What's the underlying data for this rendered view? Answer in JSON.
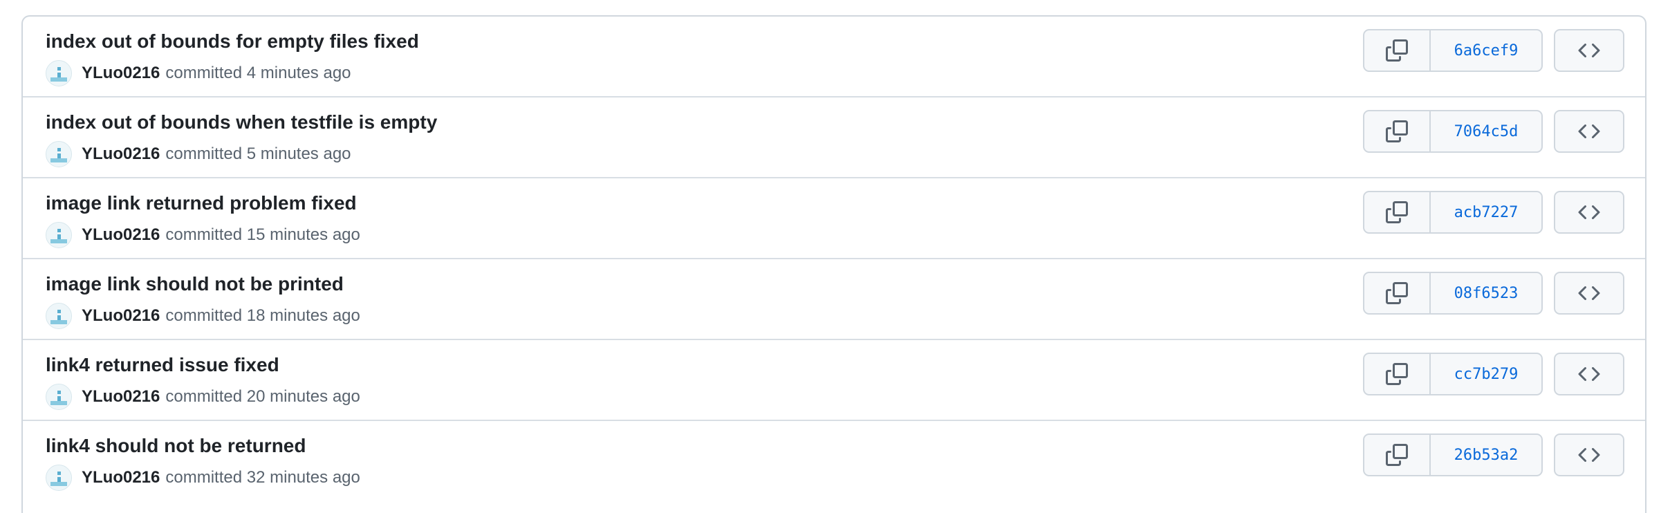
{
  "commits": [
    {
      "title": "index out of bounds for empty files fixed",
      "author": "YLuo0216",
      "committed_text": "committed 4 minutes ago",
      "sha": "6a6cef9"
    },
    {
      "title": "index out of bounds when testfile is empty",
      "author": "YLuo0216",
      "committed_text": "committed 5 minutes ago",
      "sha": "7064c5d"
    },
    {
      "title": "image link returned problem fixed",
      "author": "YLuo0216",
      "committed_text": "committed 15 minutes ago",
      "sha": "acb7227"
    },
    {
      "title": "image link should not be printed",
      "author": "YLuo0216",
      "committed_text": "committed 18 minutes ago",
      "sha": "08f6523"
    },
    {
      "title": "link4 returned issue fixed",
      "author": "YLuo0216",
      "committed_text": "committed 20 minutes ago",
      "sha": "cc7b279"
    },
    {
      "title": "link4 should not be returned",
      "author": "YLuo0216",
      "committed_text": "committed 32 minutes ago",
      "sha": "26b53a2"
    }
  ],
  "icons": {
    "copy": "copy-icon",
    "browse": "code-icon",
    "avatar": "avatar"
  },
  "colors": {
    "sha_link": "#0969da",
    "border": "#d0d7de",
    "button_bg": "#f6f8fa",
    "muted_text": "#59636e"
  }
}
